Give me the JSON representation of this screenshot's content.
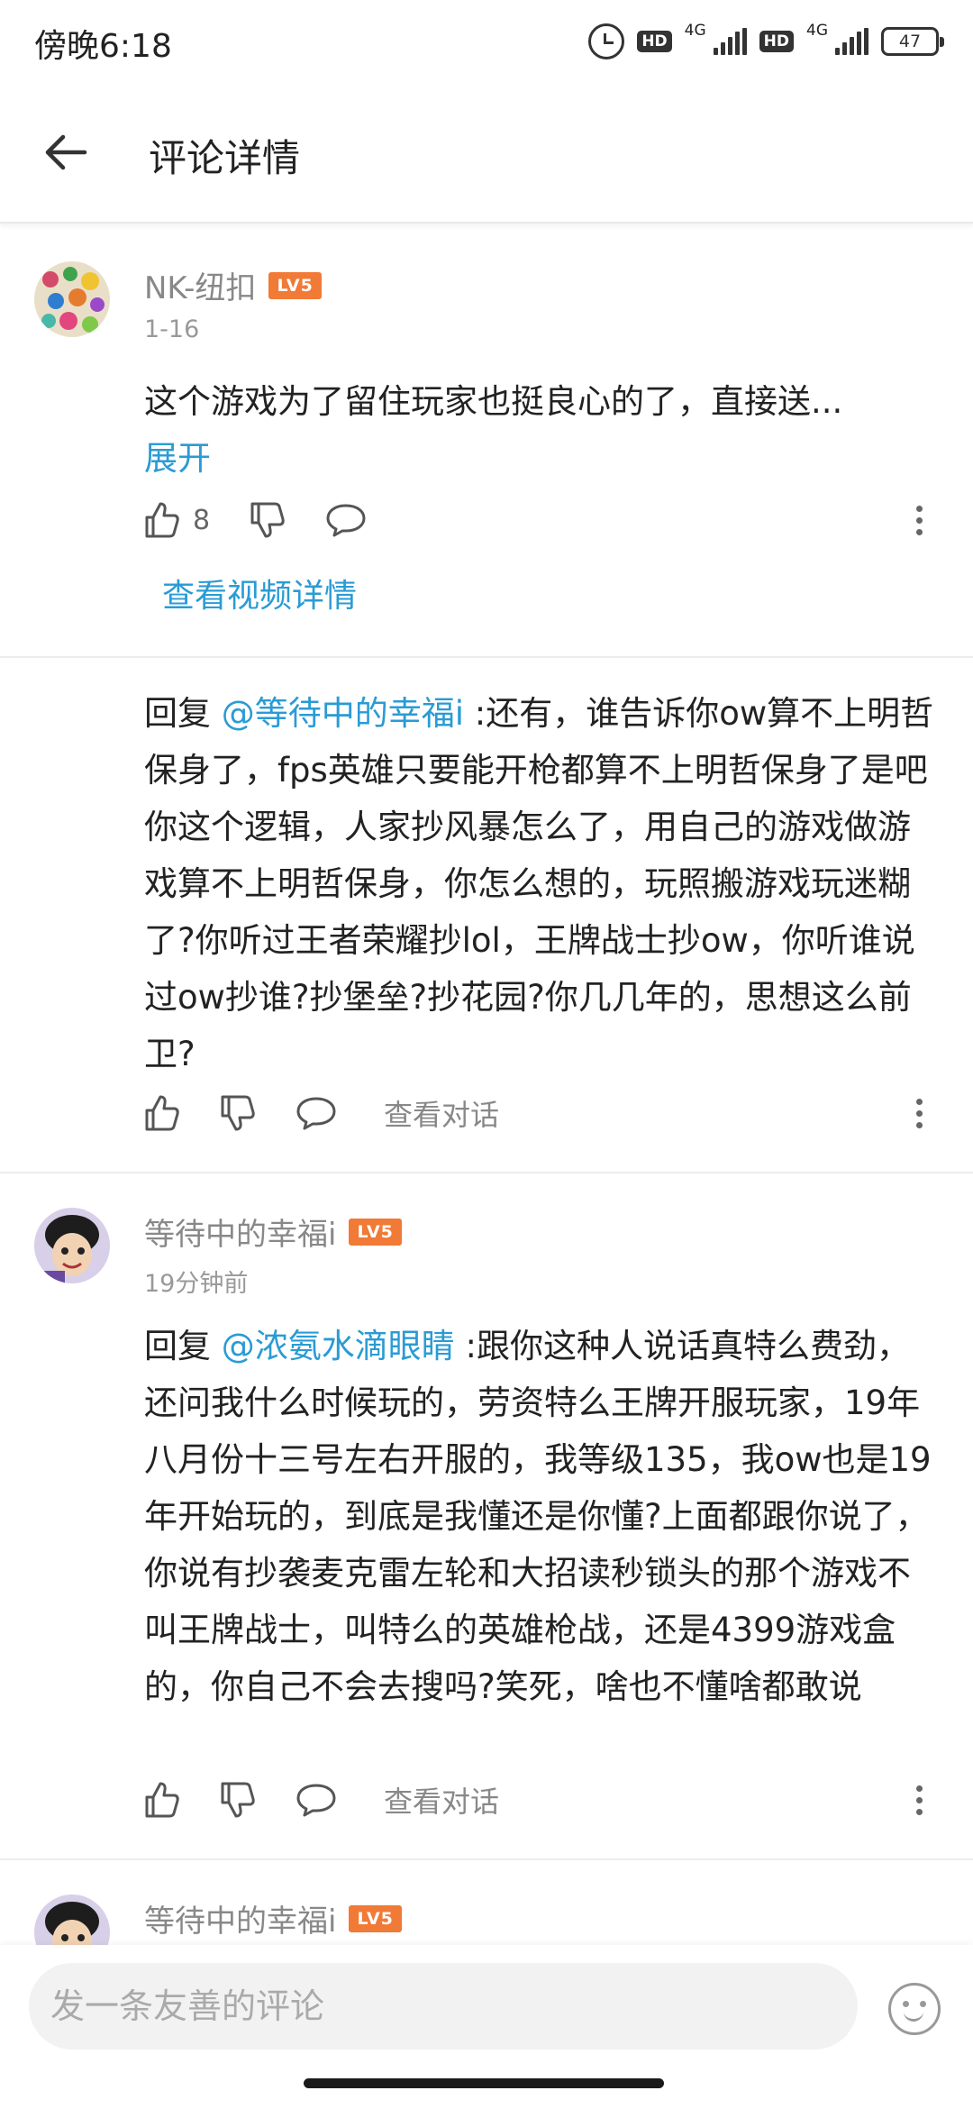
{
  "status_bar": {
    "time": "傍晚6:18",
    "hd1": "HD",
    "net1": "4G",
    "hd2": "HD",
    "net2": "4G",
    "battery": "47"
  },
  "header": {
    "title": "评论详情"
  },
  "main_comment": {
    "username": "NK-纽扣",
    "level": "LV5",
    "date": "1-16",
    "text": "这个游戏为了留住玩家也挺良心的了，直接送...",
    "expand_label": "展开",
    "like_count": "8",
    "video_link": "查看视频详情"
  },
  "replies": [
    {
      "reply_prefix": "回复 ",
      "mention": "@等待中的幸福i",
      "text": " :还有，谁告诉你ow算不上明哲保身了，fps英雄只要能开枪都算不上明哲保身了是吧你这个逻辑，人家抄风暴怎么了，用自己的游戏做游戏算不上明哲保身，你怎么想的，玩照搬游戏玩迷糊了?你听过王者荣耀抄lol，王牌战士抄ow，你听谁说过ow抄谁?抄堡垒?抄花园?你几几年的，思想这么前卫?",
      "view_conversation": "查看对话"
    },
    {
      "username": "等待中的幸福i",
      "level": "LV5",
      "date": "19分钟前",
      "reply_prefix": "回复 ",
      "mention": "@浓氨水滴眼睛",
      "text": " :跟你这种人说话真特么费劲，还问我什么时候玩的，劳资特么王牌开服玩家，19年八月份十三号左右开服的，我等级135，我ow也是19年开始玩的，到底是我懂还是你懂?上面都跟你说了，你说有抄袭麦克雷左轮和大招读秒锁头的那个游戏不叫王牌战士，叫特么的英雄枪战，还是4399游戏盒的，你自己不会去搜吗?笑死，啥也不懂啥都敢说",
      "view_conversation": "查看对话"
    },
    {
      "username": "等待中的幸福i",
      "level": "LV5"
    }
  ],
  "composer": {
    "placeholder": "发一条友善的评论"
  },
  "colors": {
    "link": "#2a9bd4",
    "level_badge": "#f07a36"
  }
}
